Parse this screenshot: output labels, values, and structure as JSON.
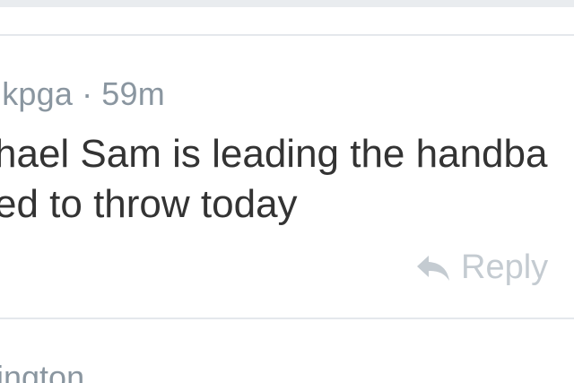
{
  "comment": {
    "username": "lkpga",
    "separator": "·",
    "time": "59m",
    "lines": [
      "hael Sam is leading the handba",
      "ed to throw today"
    ],
    "reply_label": "Reply",
    "reply_icon": "reply-arrow-icon"
  },
  "next_comment": {
    "username": "ington"
  },
  "colors": {
    "meta_text": "#8a96a0",
    "body_text": "#333333",
    "reply": "#c4cbd1",
    "divider": "#e4e8ec"
  }
}
